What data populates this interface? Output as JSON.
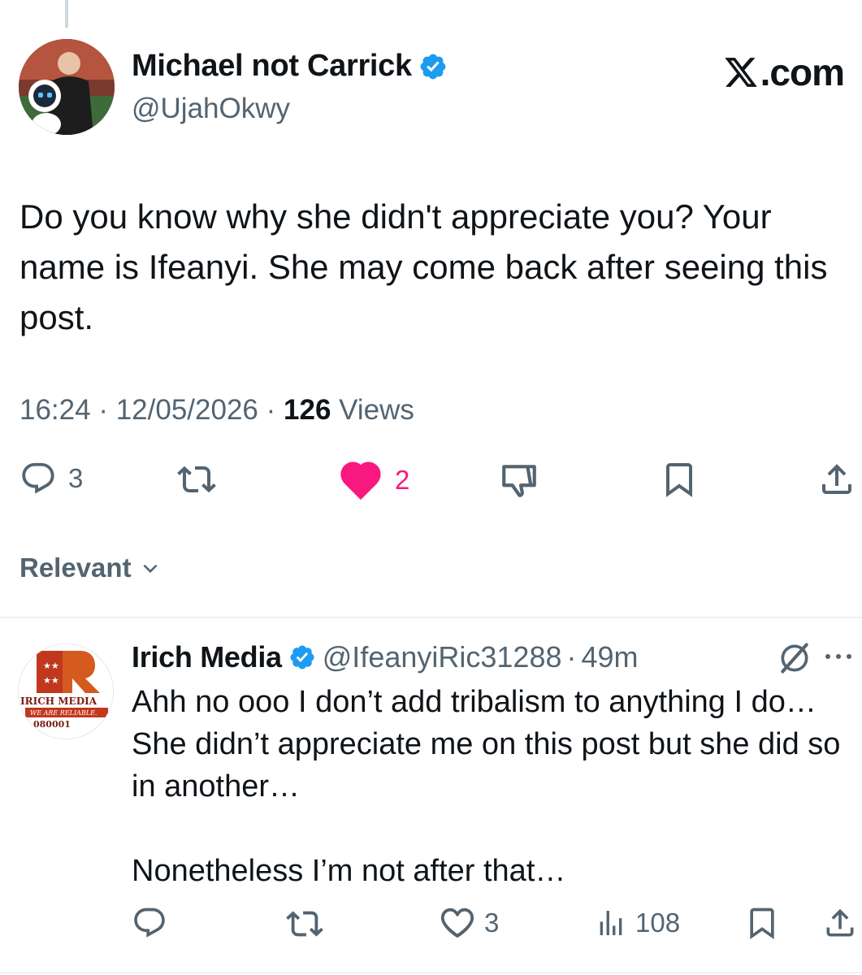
{
  "main_post": {
    "display_name": "Michael not Carrick",
    "handle": "@UjahOkwy",
    "source_label": ".com",
    "text": "Do you know why she didn't appreciate you? Your name is Ifeanyi. She may come back after seeing this post.",
    "time": "16:24",
    "date": "12/05/2026",
    "views_count": "126",
    "views_label": "Views",
    "separator": "·",
    "replies": "3",
    "likes": "2",
    "icons": [
      "reply-icon",
      "retweet-icon",
      "heart-filled-icon",
      "downvote-icon",
      "bookmark-icon",
      "share-icon",
      "verified-badge-icon",
      "x-logo-icon"
    ]
  },
  "sort": {
    "label": "Relevant"
  },
  "reply": {
    "display_name": "Irich Media",
    "handle": "@IfeanyiRic31288",
    "time": "49m",
    "separator": "·",
    "text": "Ahh no ooo I don’t add tribalism to anything I do…\nShe didn’t appreciate me on this post but she did so in another…\n\nNonetheless I’m not after that…",
    "likes": "3",
    "views": "108",
    "avatar_logo_text": "IRICH MEDIA",
    "avatar_tagline": "WE ARE RELIABLE.",
    "avatar_number": "080001",
    "icons": [
      "reply-icon",
      "retweet-icon",
      "heart-icon",
      "views-icon",
      "bookmark-icon",
      "share-icon",
      "grok-icon",
      "more-icon"
    ]
  },
  "colors": {
    "text": "#0f1419",
    "secondary": "#536471",
    "verified": "#1d9bf0",
    "like": "#f91880",
    "divider": "#eff3f4"
  }
}
